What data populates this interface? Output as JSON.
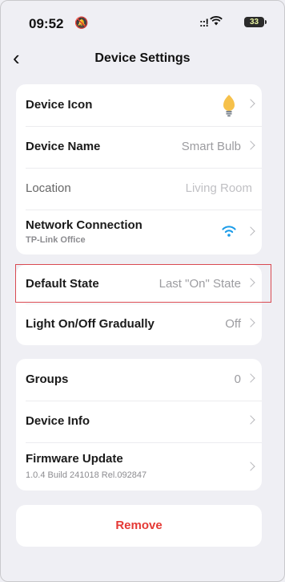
{
  "status_bar": {
    "time": "09:52",
    "battery": "33",
    "signal": "::!"
  },
  "header": {
    "title": "Device Settings"
  },
  "group1": [
    {
      "label": "Device Icon",
      "value": ""
    },
    {
      "label": "Device Name",
      "value": "Smart Bulb"
    },
    {
      "label": "Location",
      "value": "Living Room"
    },
    {
      "label": "Network Connection",
      "sub": "TP-Link Office"
    }
  ],
  "group2": [
    {
      "label": "Default State",
      "value": "Last \"On\" State"
    },
    {
      "label": "Light On/Off Gradually",
      "value": "Off"
    }
  ],
  "group3": [
    {
      "label": "Groups",
      "value": "0"
    },
    {
      "label": "Device Info",
      "value": ""
    },
    {
      "label": "Firmware Update",
      "sub": "1.0.4 Build 241018 Rel.092847"
    }
  ],
  "remove_label": "Remove",
  "colors": {
    "accent_wifi": "#1a9be8",
    "danger": "#e53935",
    "highlight_border": "#d94a52"
  },
  "icons": {
    "bulb": "bulb-icon",
    "wifi": "wifi-icon",
    "chevron": "chevron-right-icon",
    "back": "chevron-left-icon"
  }
}
